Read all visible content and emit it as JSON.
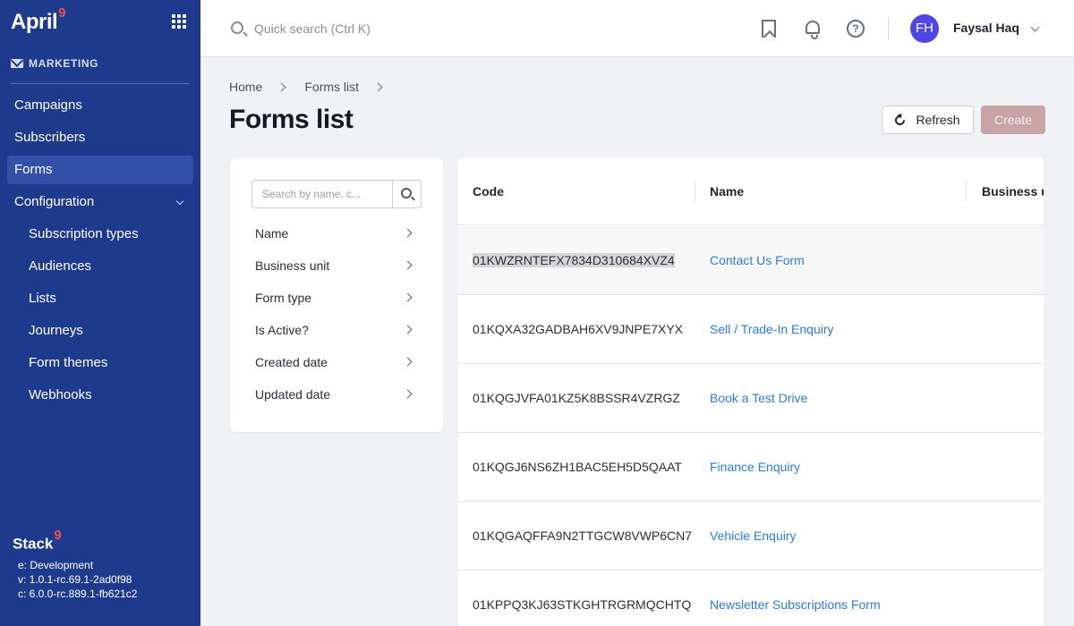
{
  "sidebar": {
    "brand": "April",
    "brand_badge": "9",
    "section_label": "MARKETING",
    "nav": [
      {
        "label": "Campaigns"
      },
      {
        "label": "Subscribers"
      },
      {
        "label": "Forms"
      },
      {
        "label": "Configuration"
      },
      {
        "label": "Subscription types"
      },
      {
        "label": "Audiences"
      },
      {
        "label": "Lists"
      },
      {
        "label": "Journeys"
      },
      {
        "label": "Form themes"
      },
      {
        "label": "Webhooks"
      }
    ],
    "stack_brand": "Stack",
    "stack_badge": "9",
    "env": "e: Development",
    "version": "v: 1.0.1-rc.69.1-2ad0f98",
    "core": "c: 6.0.0-rc.889.1-fb621c2"
  },
  "topbar": {
    "search_placeholder": "Quick search (Ctrl K)",
    "help_glyph": "?",
    "user_initials": "FH",
    "user_name": "Faysal Haq"
  },
  "breadcrumb": {
    "home": "Home",
    "current": "Forms list"
  },
  "page": {
    "title": "Forms list",
    "refresh_label": "Refresh",
    "create_label": "Create"
  },
  "filters": {
    "search_placeholder": "Search by name, c...",
    "items": [
      {
        "label": "Name"
      },
      {
        "label": "Business unit"
      },
      {
        "label": "Form type"
      },
      {
        "label": "Is Active?"
      },
      {
        "label": "Created date"
      },
      {
        "label": "Updated date"
      }
    ]
  },
  "table": {
    "columns": [
      "Code",
      "Name",
      "Business un"
    ],
    "rows": [
      {
        "code": "01KWZRNTEFX7834D310684XVZ4",
        "name": "Contact Us Form"
      },
      {
        "code": "01KQXA32GADBAH6XV9JNPE7XYX",
        "name": "Sell / Trade-In Enquiry"
      },
      {
        "code": "01KQGJVFA01KZ5K8BSSR4VZRGZ",
        "name": "Book a Test Drive"
      },
      {
        "code": "01KQGJ6NS6ZH1BAC5EH5D5QAAT",
        "name": "Finance Enquiry"
      },
      {
        "code": "01KQGAQFFA9N2TTGCW8VWP6CN7",
        "name": "Vehicle Enquiry"
      },
      {
        "code": "01KPPQ3KJ63STKGHTRGRMQCHTQ",
        "name": "Newsletter Subscriptions Form"
      }
    ]
  }
}
